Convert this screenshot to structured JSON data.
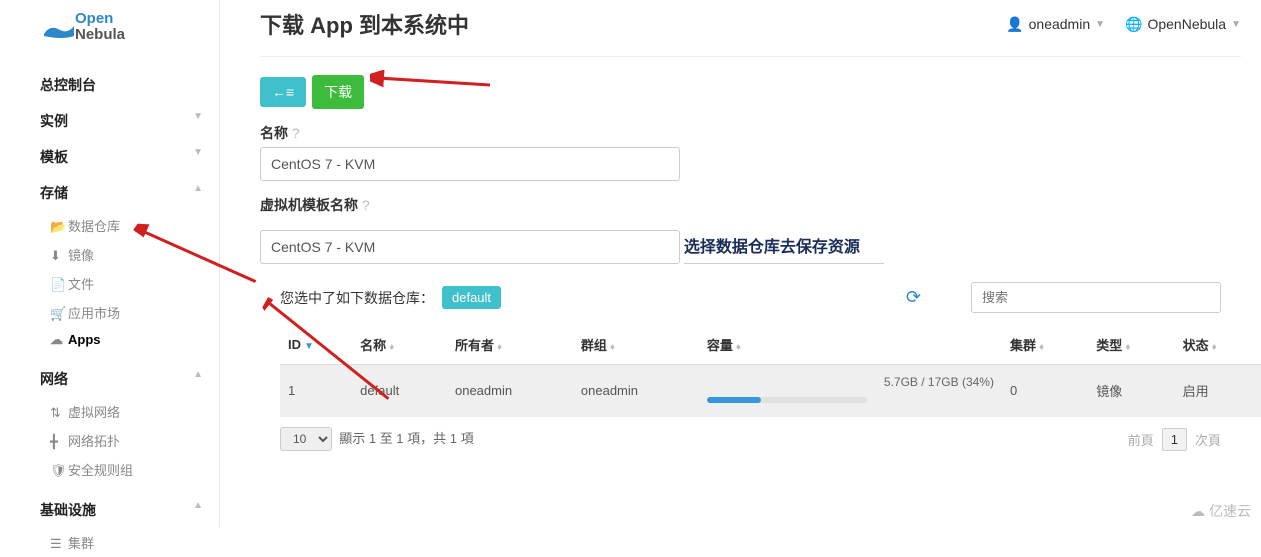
{
  "logo": {
    "top": "Open",
    "bottom": "Nebula"
  },
  "header": {
    "title": "下载 App 到本系统中",
    "user": "oneadmin",
    "brand": "OpenNebula"
  },
  "sidebar": {
    "dashboard": "总控制台",
    "instances": "实例",
    "templates": "模板",
    "storage": "存储",
    "storage_items": {
      "datastores": "数据仓库",
      "images": "镜像",
      "files": "文件",
      "marketplace": "应用市场",
      "apps": "Apps"
    },
    "network": "网络",
    "network_items": {
      "vnet": "虚拟网络",
      "topology": "网络拓扑",
      "secgroups": "安全规则组"
    },
    "infra": "基础设施",
    "infra_items": {
      "cluster": "集群"
    }
  },
  "buttons": {
    "back": "←≡",
    "download": "下载"
  },
  "form": {
    "name_label": "名称",
    "name_value": "CentOS 7 - KVM",
    "tpl_label": "虚拟机模板名称",
    "tpl_value": "CentOS 7 - KVM",
    "section_title": "选择数据仓库去保存资源"
  },
  "selection": {
    "text": "您选中了如下数据仓库：",
    "tag": "default",
    "search_placeholder": "搜索"
  },
  "table": {
    "headers": {
      "id": "ID",
      "name": "名称",
      "owner": "所有者",
      "group": "群组",
      "capacity": "容量",
      "cluster": "集群",
      "type": "类型",
      "status": "状态"
    },
    "row": {
      "id": "1",
      "name": "default",
      "owner": "oneadmin",
      "group": "oneadmin",
      "capacity_text": "5.7GB / 17GB (34%)",
      "capacity_percent": 34,
      "cluster": "0",
      "type": "镜像",
      "status": "启用"
    }
  },
  "pager": {
    "page_size": "10",
    "info": "顯示 1 至 1 項，共 1 項",
    "prev": "前頁",
    "current": "1",
    "next": "次頁"
  },
  "watermark": "亿速云"
}
